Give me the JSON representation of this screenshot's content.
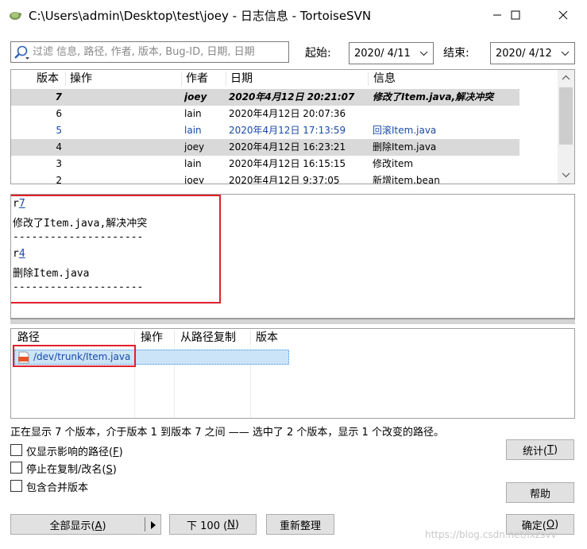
{
  "window": {
    "title": "C:\\Users\\admin\\Desktop\\test\\joey - 日志信息 - TortoiseSVN",
    "app_icon": "tortoise-icon"
  },
  "filter": {
    "search_placeholder": "过滤 信息, 路径, 作者, 版本, Bug-ID, 日期, 日期",
    "from_label": "起始:",
    "from_date": "2020/  4/11",
    "to_label": "结束:",
    "to_date": "2020/  4/12"
  },
  "log": {
    "columns": [
      "版本",
      "操作",
      "作者",
      "日期",
      "信息"
    ],
    "rows": [
      {
        "rev": "7",
        "author": "joey",
        "date": "2020年4月12日 20:21:07",
        "message": "修改了Item.java,解决冲突",
        "icons": [
          "conflict-icon",
          "file-icon"
        ]
      },
      {
        "rev": "6",
        "author": "lain",
        "date": "2020年4月12日 20:07:36",
        "message": "",
        "icons": [
          "conflict-icon",
          "file-icon"
        ]
      },
      {
        "rev": "5",
        "author": "lain",
        "date": "2020年4月12日 17:13:59",
        "message": "回滚Item.java",
        "icons": [
          "add-icon"
        ]
      },
      {
        "rev": "4",
        "author": "joey",
        "date": "2020年4月12日 16:23:21",
        "message": "删除Item.java",
        "icons": [
          "delete-icon"
        ]
      },
      {
        "rev": "3",
        "author": "lain",
        "date": "2020年4月12日 16:15:15",
        "message": "修改item",
        "icons": [
          "conflict-icon",
          "file-icon"
        ]
      },
      {
        "rev": "2",
        "author": "joey",
        "date": "2020年4月12日 9:37:05",
        "message": "新增item.bean",
        "icons": [
          "add-icon"
        ]
      }
    ]
  },
  "message": {
    "r1_prefix": "r",
    "r1_num": "7",
    "r1_text": "修改了Item.java,解决冲突",
    "sep": "---------------------",
    "r2_prefix": "r",
    "r2_num": "4",
    "r2_text": "删除Item.java"
  },
  "paths": {
    "columns": [
      "路径",
      "操作",
      "从路径复制",
      "版本"
    ],
    "rows": [
      {
        "path": "/dev/trunk/Item.java",
        "icon": "java-file-icon"
      }
    ]
  },
  "status_text": "正在显示 7 个版本，介于版本 1 到版本 7 之间 —— 选中了 2 个版本，显示 1 个改变的路径。",
  "options": {
    "affected_only": {
      "pre": "仅显示影响的路径(",
      "key": "F",
      "post": ")",
      "checked": false
    },
    "stop_on_copy": {
      "pre": "停止在复制/改名(",
      "key": "S",
      "post": ")",
      "checked": false
    },
    "include_merged": {
      "label": "包含合并版本",
      "checked": false
    }
  },
  "buttons": {
    "stats": {
      "pre": "统计(",
      "key": "T",
      "post": ")"
    },
    "help": "帮助",
    "show_all": {
      "pre": "全部显示(",
      "key": "A",
      "post": ")"
    },
    "next_100": {
      "pre": "下 100 (",
      "key": "N",
      "post": ")"
    },
    "refresh": "重新整理",
    "ok": {
      "pre": "确定(",
      "key": "O",
      "post": ")"
    }
  },
  "watermark": "https://blog.csdn.net/lxzsvv",
  "colors": {
    "highlight_box": "#e0202a",
    "link_blue": "#1a4aa8",
    "conflict_red": "#d9232d"
  }
}
